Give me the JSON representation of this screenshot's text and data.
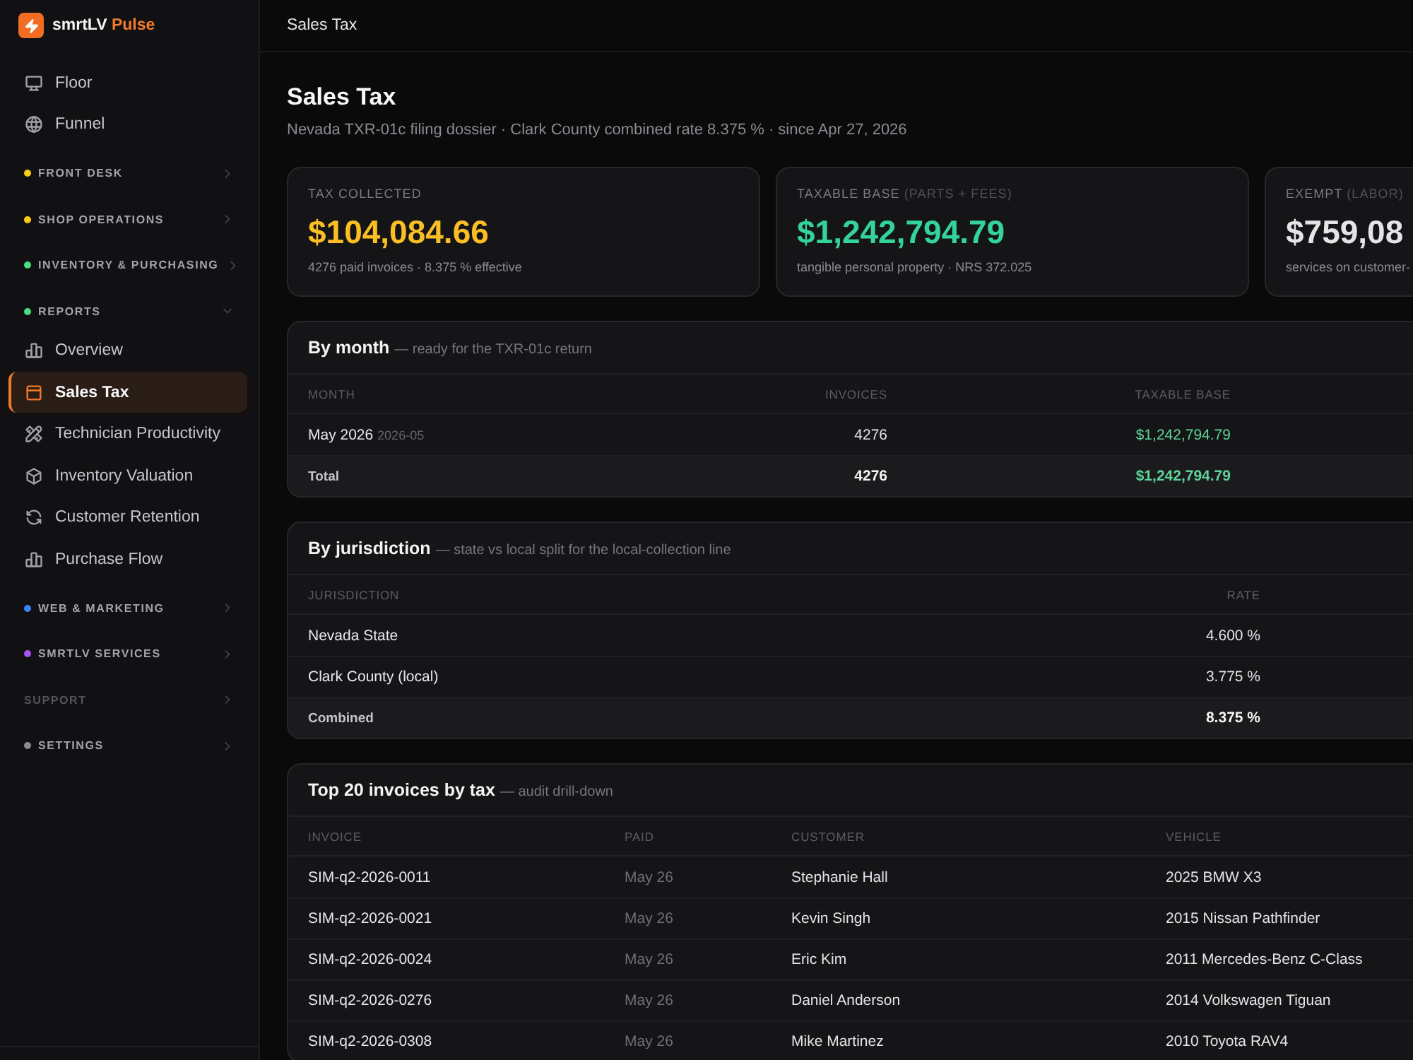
{
  "sidebar": {
    "brand": {
      "name": "smrtLV",
      "accent": "Pulse"
    },
    "items": [
      {
        "kind": "link",
        "label": "Floor",
        "selected": false
      },
      {
        "kind": "link",
        "label": "Funnel",
        "selected": false
      },
      {
        "kind": "section",
        "label": "FRONT DESK",
        "color": "#facc15",
        "expanded": false,
        "disabled": false
      },
      {
        "kind": "section",
        "label": "SHOP OPERATIONS",
        "color": "#facc15",
        "expanded": false,
        "disabled": false
      },
      {
        "kind": "section",
        "label": "INVENTORY & PURCHASING",
        "color": "#4ade80",
        "expanded": false,
        "disabled": false
      },
      {
        "kind": "section",
        "label": "REPORTS",
        "color": "#4ade80",
        "expanded": true,
        "disabled": false,
        "children": [
          {
            "label": "Overview",
            "selected": false
          },
          {
            "label": "Sales Tax",
            "selected": true
          },
          {
            "label": "Technician Productivity",
            "selected": false
          },
          {
            "label": "Inventory Valuation",
            "selected": false
          },
          {
            "label": "Customer Retention",
            "selected": false
          },
          {
            "label": "Purchase Flow",
            "selected": false
          }
        ]
      },
      {
        "kind": "section",
        "label": "WEB & MARKETING",
        "color": "#3b82f6",
        "expanded": false,
        "disabled": false
      },
      {
        "kind": "section",
        "label": "SMRTLV SERVICES",
        "color": "#a855f7",
        "expanded": false,
        "disabled": false
      },
      {
        "kind": "section",
        "label": "SUPPORT",
        "expanded": false,
        "disabled": true
      },
      {
        "kind": "section",
        "label": "SETTINGS",
        "color": "#8a8a90",
        "expanded": false,
        "disabled": false
      }
    ]
  },
  "topbar": {
    "title": "Sales Tax"
  },
  "page": {
    "title": "Sales Tax",
    "subtitle": "Nevada TXR-01c filing dossier · Clark County combined rate 8.375 % · since Apr 27, 2026"
  },
  "stats": [
    {
      "label": "TAX COLLECTED",
      "value": "$104,084.66",
      "color": "#fbbf24",
      "note": "4276 paid invoices · 8.375 % effective"
    },
    {
      "label": "TAXABLE BASE",
      "label_note": "(PARTS + FEES)",
      "value": "$1,242,794.79",
      "color": "#34d399",
      "note": "tangible personal property · NRS 372.025"
    },
    {
      "label": "EXEMPT",
      "label_note": "(LABOR)",
      "value": "$759,08",
      "color": "#e4e4e7",
      "note": "services on customer-"
    }
  ],
  "tables": [
    {
      "title": "By month",
      "note": "— ready for the TXR-01c return",
      "columns": [
        "MONTH",
        "INVOICES",
        "TAXABLE BASE"
      ],
      "rows": [
        {
          "kind": "data",
          "cells": [
            "May 2026",
            "4276",
            "$1,242,794.79"
          ],
          "sub": "2026-05"
        },
        {
          "kind": "total",
          "cells": [
            "Total",
            "4276",
            "$1,242,794.79"
          ]
        }
      ]
    },
    {
      "title": "By jurisdiction",
      "note": "— state vs local split for the local-collection line",
      "columns": [
        "JURISDICTION",
        "RATE"
      ],
      "rows": [
        {
          "kind": "data",
          "cells": [
            "Nevada State",
            "4.600 %"
          ]
        },
        {
          "kind": "data",
          "cells": [
            "Clark County (local)",
            "3.775 %"
          ]
        },
        {
          "kind": "total",
          "cells": [
            "Combined",
            "8.375 %"
          ]
        }
      ]
    },
    {
      "title": "Top 20 invoices by tax",
      "note": "— audit drill-down",
      "columns": [
        "INVOICE",
        "PAID",
        "CUSTOMER",
        "VEHICLE"
      ],
      "rows": [
        {
          "kind": "data",
          "cells": [
            "SIM-q2-2026-0011",
            "May 26",
            "Stephanie Hall",
            "2025 BMW X3"
          ]
        },
        {
          "kind": "data",
          "cells": [
            "SIM-q2-2026-0021",
            "May 26",
            "Kevin Singh",
            "2015 Nissan Pathfinder"
          ]
        },
        {
          "kind": "data",
          "cells": [
            "SIM-q2-2026-0024",
            "May 26",
            "Eric Kim",
            "2011 Mercedes-Benz C-Class"
          ]
        },
        {
          "kind": "data",
          "cells": [
            "SIM-q2-2026-0276",
            "May 26",
            "Daniel Anderson",
            "2014 Volkswagen Tiguan"
          ]
        },
        {
          "kind": "data",
          "cells": [
            "SIM-q2-2026-0308",
            "May 26",
            "Mike Martinez",
            "2010 Toyota RAV4"
          ]
        }
      ]
    }
  ]
}
